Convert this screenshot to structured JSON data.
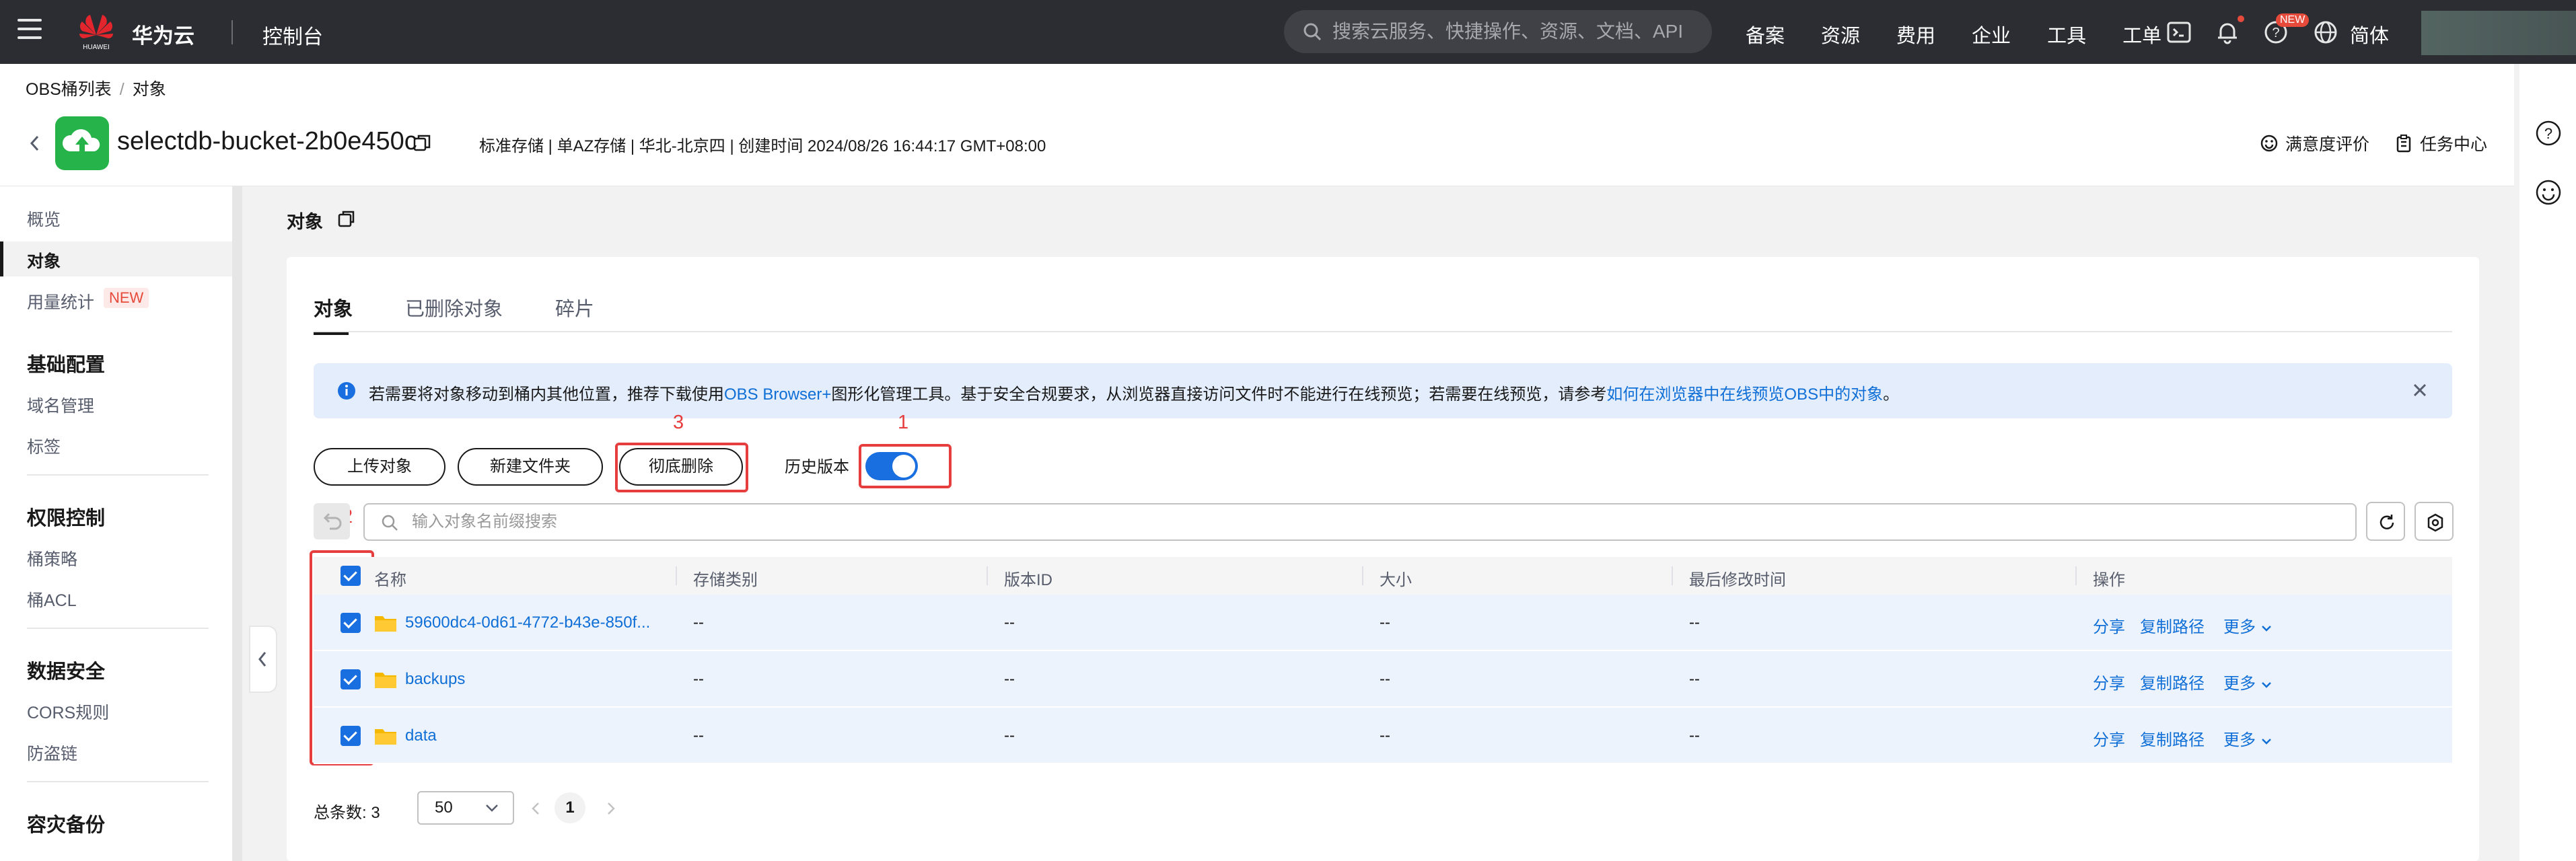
{
  "topnav": {
    "brand": "华为云",
    "logo_text": "HUAWEI",
    "console": "控制台",
    "search_placeholder": "搜索云服务、快捷操作、资源、文档、API",
    "links": [
      "备案",
      "资源",
      "费用",
      "企业",
      "工具",
      "工单"
    ],
    "new_badge": "NEW",
    "language": "简体"
  },
  "header": {
    "breadcrumb": [
      "OBS桶列表",
      "对象"
    ],
    "bucket_name": "selectdb-bucket-2b0e450c",
    "bucket_meta": "标准存储 | 单AZ存储 | 华北-北京四 | 创建时间  2024/08/26 16:44:17 GMT+08:00",
    "satisfaction": "满意度评价",
    "task_center": "任务中心"
  },
  "sidebar": {
    "overview": "概览",
    "objects": "对象",
    "usage": "用量统计",
    "usage_tag": "NEW",
    "group_basic": "基础配置",
    "domain": "域名管理",
    "tags": "标签",
    "group_perm": "权限控制",
    "bucket_policy": "桶策略",
    "bucket_acl": "桶ACL",
    "group_security": "数据安全",
    "cors": "CORS规则",
    "hotlink": "防盗链",
    "group_dr": "容灾备份"
  },
  "main": {
    "title": "对象",
    "tabs": [
      "对象",
      "已删除对象",
      "碎片"
    ],
    "notice": {
      "part1": "若需要将对象移动到桶内其他位置，推荐下载使用",
      "link1": "OBS Browser+",
      "part2": "图形化管理工具。基于安全合规要求，从浏览器直接访问文件时不能进行在线预览；若需要在线预览，请参考",
      "link2": "如何在浏览器中在线预览OBS中的对象",
      "part3": "。"
    },
    "buttons": {
      "upload": "上传对象",
      "new_folder": "新建文件夹",
      "delete_all": "彻底删除"
    },
    "history_label": "历史版本",
    "history_enabled": true,
    "search_placeholder": "输入对象名前缀搜索",
    "annotations": [
      "1",
      "2",
      "3"
    ],
    "columns": [
      "名称",
      "存储类别",
      "版本ID",
      "大小",
      "最后修改时间",
      "操作"
    ],
    "rows": [
      {
        "name": "59600dc4-0d61-4772-b43e-850f...",
        "storage": "--",
        "version": "--",
        "size": "--",
        "modified": "--"
      },
      {
        "name": "backups",
        "storage": "--",
        "version": "--",
        "size": "--",
        "modified": "--"
      },
      {
        "name": "data",
        "storage": "--",
        "version": "--",
        "size": "--",
        "modified": "--"
      }
    ],
    "ops": {
      "share": "分享",
      "copy_path": "复制路径",
      "more": "更多"
    },
    "footer": {
      "total_label": "总条数:",
      "total": "3",
      "page_size": "50",
      "current_page": "1"
    }
  },
  "colors": {
    "accent": "#1a6fe0",
    "link": "#0f6fd6",
    "annotation": "#e63e3e",
    "nav_bg": "#2b2d33",
    "bucket_icon": "#26b34a"
  },
  "icons": [
    "menu-icon",
    "huawei-logo",
    "search-icon",
    "terminal-icon",
    "bell-icon",
    "help-icon",
    "globe-icon",
    "copy-icon",
    "cloud-upload-icon",
    "smile-icon",
    "clipboard-icon",
    "info-icon",
    "close-icon",
    "undo-icon",
    "refresh-icon",
    "settings-icon",
    "folder-icon",
    "chevron-down-icon"
  ]
}
